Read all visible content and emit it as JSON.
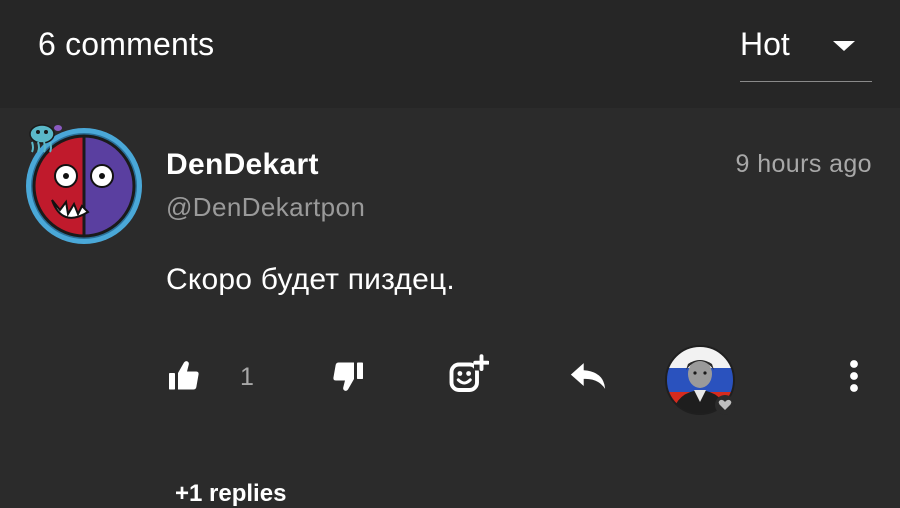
{
  "header": {
    "comment_count": "6 comments",
    "sort": {
      "selected": "Hot",
      "icon": "caret-down-icon"
    }
  },
  "comment": {
    "username": "DenDekart",
    "handle": "@DenDekartpon",
    "time": "9 hours ago",
    "text": "Скоро будет пиздец.",
    "likes": "1",
    "replies_label": "+1 replies",
    "icons": {
      "like": "thumbs-up-icon",
      "dislike": "thumbs-down-icon",
      "react": "add-reaction-icon",
      "reply": "reply-icon",
      "more": "more-vertical-icon",
      "reaction_badge": "heart-icon"
    }
  },
  "colors": {
    "background": "#2b2b2b",
    "header_background": "#262626",
    "avatar_ring": "#4aa8d8",
    "avatar_left": "#c01a2c",
    "avatar_right": "#5a3fa0",
    "muted_text": "#9a9a9a"
  }
}
